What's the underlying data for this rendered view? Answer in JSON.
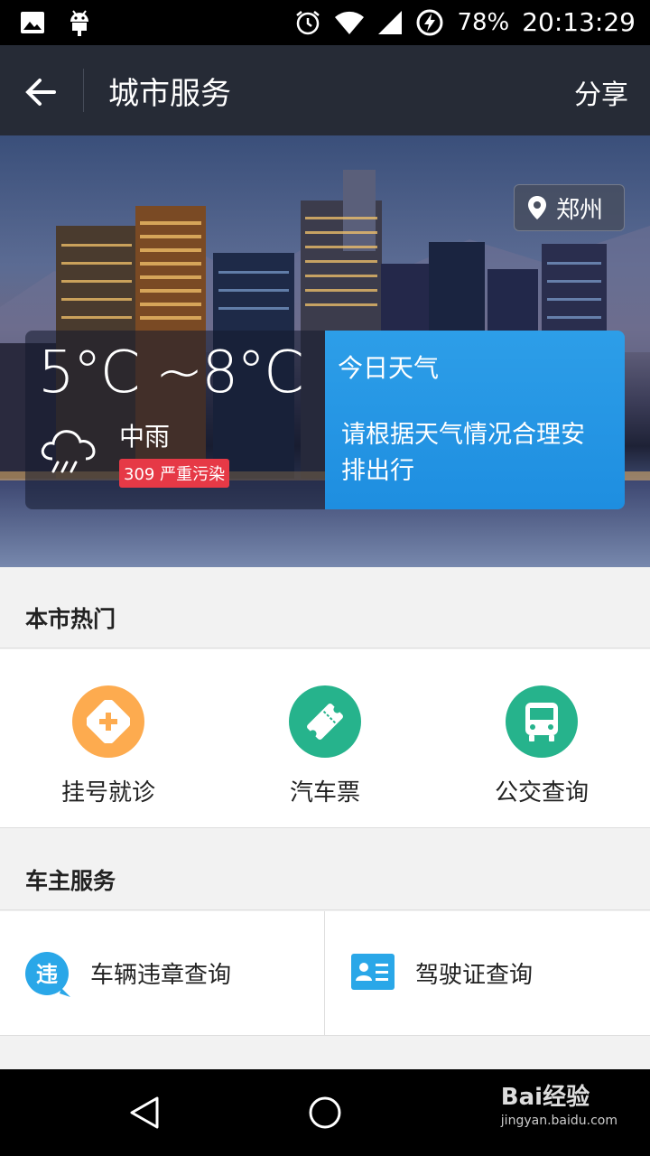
{
  "status_bar": {
    "battery": "78%",
    "time": "20:13:29",
    "icons": [
      "image-icon",
      "android-icon",
      "alarm-icon",
      "wifi-icon",
      "signal-icon",
      "battery-charging-icon"
    ]
  },
  "app_bar": {
    "title": "城市服务",
    "share_label": "分享"
  },
  "hero": {
    "location": "郑州",
    "weather": {
      "temperature": "5°C ~8°C",
      "condition": "中雨",
      "aqi": "309 严重污染",
      "panel_title": "今日天气",
      "advice": "请根据天气情况合理安排出行"
    }
  },
  "hot_section": {
    "title": "本市热门",
    "items": [
      {
        "label": "挂号就诊",
        "icon": "hospital-plus-icon",
        "color": "#fdab4f"
      },
      {
        "label": "汽车票",
        "icon": "ticket-icon",
        "color": "#26b38c"
      },
      {
        "label": "公交查询",
        "icon": "bus-icon",
        "color": "#26b38c"
      }
    ]
  },
  "owner_section": {
    "title": "车主服务",
    "items": [
      {
        "label": "车辆违章查询",
        "icon": "violation-icon",
        "icon_text": "违",
        "color": "#2aa7e8"
      },
      {
        "label": "驾驶证查询",
        "icon": "license-card-icon",
        "color": "#2aa7e8"
      }
    ]
  },
  "watermark": {
    "logo": "Bai经验",
    "url": "jingyan.baidu.com"
  }
}
